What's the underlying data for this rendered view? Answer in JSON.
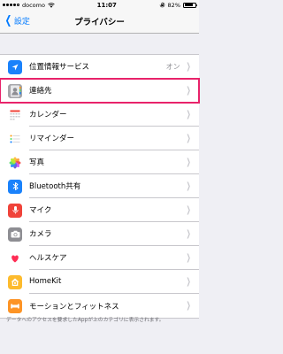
{
  "status": {
    "carrier": "docomo",
    "time": "11:07",
    "battery_percent": "82%",
    "battery_level": 0.82
  },
  "nav": {
    "back_label": "設定",
    "title": "プライバシー"
  },
  "rows": [
    {
      "id": "location",
      "label": "位置情報サービス",
      "value": "オン",
      "icon": "location-arrow-icon",
      "color": "#1a82fb"
    },
    {
      "id": "contacts",
      "label": "連絡先",
      "value": "",
      "icon": "contacts-icon",
      "color": "#9b9b9b",
      "highlighted": true
    },
    {
      "id": "calendar",
      "label": "カレンダー",
      "value": "",
      "icon": "calendar-icon",
      "color": "#ffffff"
    },
    {
      "id": "reminders",
      "label": "リマインダー",
      "value": "",
      "icon": "reminders-icon",
      "color": "#ffffff"
    },
    {
      "id": "photos",
      "label": "写真",
      "value": "",
      "icon": "photos-icon",
      "color": "#ffffff"
    },
    {
      "id": "bluetooth",
      "label": "Bluetooth共有",
      "value": "",
      "icon": "bluetooth-icon",
      "color": "#1a82fb"
    },
    {
      "id": "microphone",
      "label": "マイク",
      "value": "",
      "icon": "microphone-icon",
      "color": "#f0433a"
    },
    {
      "id": "camera",
      "label": "カメラ",
      "value": "",
      "icon": "camera-icon",
      "color": "#8e8e93"
    },
    {
      "id": "health",
      "label": "ヘルスケア",
      "value": "",
      "icon": "health-heart-icon",
      "color": "#ffffff"
    },
    {
      "id": "homekit",
      "label": "HomeKit",
      "value": "",
      "icon": "homekit-house-icon",
      "color": "#fdbb2d"
    },
    {
      "id": "motion",
      "label": "モーションとフィットネス",
      "value": "",
      "icon": "motion-fitness-icon",
      "color": "#fd9426"
    }
  ],
  "footer": {
    "text": "データへのアクセスを要求したAppが上のカテゴリに表示されます。"
  },
  "colors": {
    "accent": "#007aff",
    "highlight": "#e8236a",
    "background": "#efeff4"
  }
}
